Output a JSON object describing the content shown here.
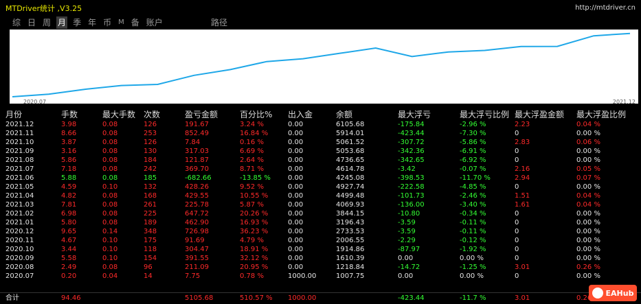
{
  "window": {
    "title": "MTDriver统计 ,V3.25",
    "url": "http://mtdriver.cn"
  },
  "tabs": [
    {
      "label": "综",
      "active": false
    },
    {
      "label": "日",
      "active": false
    },
    {
      "label": "周",
      "active": false
    },
    {
      "label": "月",
      "active": true
    },
    {
      "label": "季",
      "active": false
    },
    {
      "label": "年",
      "active": false
    },
    {
      "label": "币",
      "active": false
    },
    {
      "label": "M",
      "active": false
    },
    {
      "label": "备",
      "active": false
    },
    {
      "label": "账户",
      "active": false
    }
  ],
  "tab_path": "路径",
  "chart": {
    "x_start": "2020.07",
    "x_end": "2021.12",
    "line_color": "#1ea7e8",
    "values": [
      1007.75,
      1218.84,
      1610.39,
      1914.86,
      2006.55,
      2733.53,
      3196.43,
      3844.15,
      4069.93,
      4499.48,
      4927.74,
      4245.08,
      4614.78,
      4736.65,
      5053.68,
      5061.52,
      5914.01,
      6105.68
    ]
  },
  "table": {
    "headers": [
      "月份",
      "手数",
      "最大手数",
      "次数",
      "盈亏金额",
      "百分比%",
      "出入金",
      "余额",
      "最大浮亏",
      "最大浮亏比例",
      "最大浮盈金额",
      "最大浮盈比例"
    ],
    "rows": [
      [
        "2021.12",
        "3.98",
        "0.08",
        "126",
        "191.67",
        "3.24 %",
        "0.00",
        "6105.68",
        "-175.84",
        "-2.96 %",
        "2.23",
        "0.04 %"
      ],
      [
        "2021.11",
        "8.66",
        "0.08",
        "253",
        "852.49",
        "16.84 %",
        "0.00",
        "5914.01",
        "-423.44",
        "-7.30 %",
        "0",
        "0.00 %"
      ],
      [
        "2021.10",
        "3.87",
        "0.08",
        "126",
        "7.84",
        "0.16 %",
        "0.00",
        "5061.52",
        "-307.72",
        "-5.86 %",
        "2.83",
        "0.06 %"
      ],
      [
        "2021.09",
        "3.16",
        "0.08",
        "130",
        "317.03",
        "6.69 %",
        "0.00",
        "5053.68",
        "-342.36",
        "-6.91 %",
        "0",
        "0.00 %"
      ],
      [
        "2021.08",
        "5.86",
        "0.08",
        "184",
        "121.87",
        "2.64 %",
        "0.00",
        "4736.65",
        "-342.65",
        "-6.92 %",
        "0",
        "0.00 %"
      ],
      [
        "2021.07",
        "7.18",
        "0.08",
        "242",
        "369.70",
        "8.71 %",
        "0.00",
        "4614.78",
        "-3.42",
        "-0.07 %",
        "2.16",
        "0.05 %"
      ],
      [
        "2021.06",
        "5.88",
        "0.08",
        "185",
        "-682.66",
        "-13.85 %",
        "0.00",
        "4245.08",
        "-398.53",
        "-11.70 %",
        "2.94",
        "0.07 %"
      ],
      [
        "2021.05",
        "4.59",
        "0.10",
        "132",
        "428.26",
        "9.52 %",
        "0.00",
        "4927.74",
        "-222.58",
        "-4.85 %",
        "0",
        "0.00 %"
      ],
      [
        "2021.04",
        "4.82",
        "0.08",
        "168",
        "429.55",
        "10.55 %",
        "0.00",
        "4499.48",
        "-101.73",
        "-2.46 %",
        "1.51",
        "0.04 %"
      ],
      [
        "2021.03",
        "7.81",
        "0.08",
        "261",
        "225.78",
        "5.87 %",
        "0.00",
        "4069.93",
        "-136.00",
        "-3.40 %",
        "1.61",
        "0.04 %"
      ],
      [
        "2021.02",
        "6.98",
        "0.08",
        "225",
        "647.72",
        "20.26 %",
        "0.00",
        "3844.15",
        "-10.80",
        "-0.34 %",
        "0",
        "0.00 %"
      ],
      [
        "2021.01",
        "5.80",
        "0.08",
        "189",
        "462.90",
        "16.93 %",
        "0.00",
        "3196.43",
        "-3.59",
        "-0.11 %",
        "0",
        "0.00 %"
      ],
      [
        "2020.12",
        "9.65",
        "0.14",
        "348",
        "726.98",
        "36.23 %",
        "0.00",
        "2733.53",
        "-3.59",
        "-0.11 %",
        "0",
        "0.00 %"
      ],
      [
        "2020.11",
        "4.67",
        "0.10",
        "175",
        "91.69",
        "4.79 %",
        "0.00",
        "2006.55",
        "-2.29",
        "-0.12 %",
        "0",
        "0.00 %"
      ],
      [
        "2020.10",
        "3.44",
        "0.10",
        "118",
        "304.47",
        "18.91 %",
        "0.00",
        "1914.86",
        "-87.97",
        "-1.92 %",
        "0",
        "0.00 %"
      ],
      [
        "2020.09",
        "5.58",
        "0.10",
        "154",
        "391.55",
        "32.12 %",
        "0.00",
        "1610.39",
        "0.00",
        "0.00 %",
        "0",
        "0.00 %"
      ],
      [
        "2020.08",
        "2.49",
        "0.08",
        "96",
        "211.09",
        "20.95 %",
        "0.00",
        "1218.84",
        "-14.72",
        "-1.25 %",
        "3.01",
        "0.26 %"
      ],
      [
        "2020.07",
        "0.20",
        "0.04",
        "14",
        "7.75",
        "0.78 %",
        "1000.00",
        "1007.75",
        "0.00",
        "0.00 %",
        "0",
        "0.00 %"
      ]
    ],
    "total": [
      "合计",
      "94.46",
      "",
      "",
      "5105.68",
      "510.57 %",
      "1000.00",
      "",
      "-423.44",
      "-11.7 %",
      "3.01",
      "0.26 %"
    ]
  },
  "colors": {
    "positive": "#ff2a2a",
    "negative": "#33ff33",
    "neutral": "#e6e6e6",
    "title": "#e8e800"
  },
  "logo": {
    "text": "EAHub"
  }
}
